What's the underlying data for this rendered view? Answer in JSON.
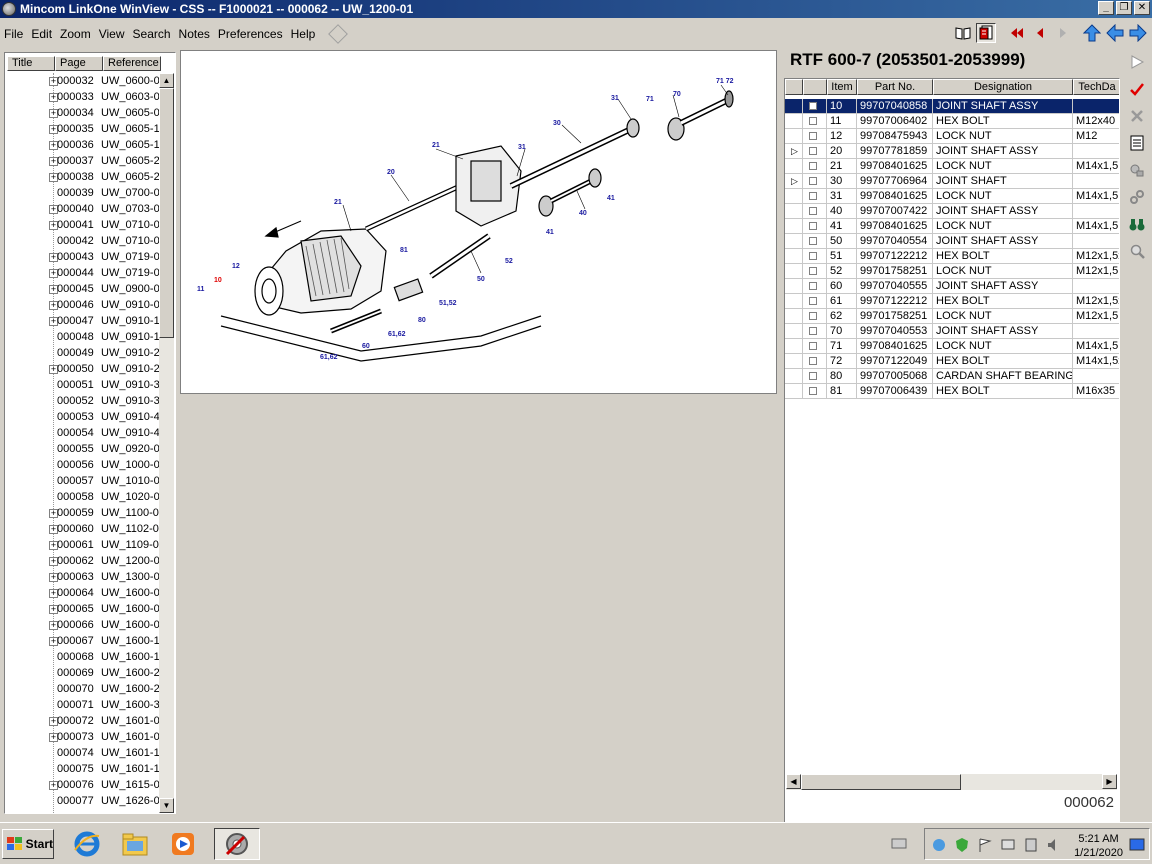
{
  "window": {
    "title": "Mincom LinkOne WinView - CSS -- F1000021 -- 000062 -- UW_1200-01",
    "buttons": [
      "_",
      "❐",
      "✕"
    ]
  },
  "menu": [
    {
      "label": "File"
    },
    {
      "label": "Edit"
    },
    {
      "label": "Zoom"
    },
    {
      "label": "View"
    },
    {
      "label": "Search"
    },
    {
      "label": "Notes"
    },
    {
      "label": "Preferences"
    },
    {
      "label": "Help"
    }
  ],
  "tree": {
    "headers": [
      "Title",
      "Page",
      "Reference"
    ],
    "rows": [
      {
        "title": "000032",
        "page": "UW_0600-0",
        "exp": true
      },
      {
        "title": "000033",
        "page": "UW_0603-0",
        "exp": true
      },
      {
        "title": "000034",
        "page": "UW_0605-0",
        "exp": true
      },
      {
        "title": "000035",
        "page": "UW_0605-1(",
        "exp": true
      },
      {
        "title": "000036",
        "page": "UW_0605-1!",
        "exp": true
      },
      {
        "title": "000037",
        "page": "UW_0605-2(",
        "exp": true
      },
      {
        "title": "000038",
        "page": "UW_0605-2!",
        "exp": true
      },
      {
        "title": "000039",
        "page": "UW_0700-0",
        "exp": false
      },
      {
        "title": "000040",
        "page": "UW_0703-0",
        "exp": true
      },
      {
        "title": "000041",
        "page": "UW_0710-0",
        "exp": true
      },
      {
        "title": "000042",
        "page": "UW_0710-0",
        "exp": false
      },
      {
        "title": "000043",
        "page": "UW_0719-0",
        "exp": true
      },
      {
        "title": "000044",
        "page": "UW_0719-0!",
        "exp": true
      },
      {
        "title": "000045",
        "page": "UW_0900-0",
        "exp": true
      },
      {
        "title": "000046",
        "page": "UW_0910-0",
        "exp": true
      },
      {
        "title": "000047",
        "page": "UW_0910-1(",
        "exp": true
      },
      {
        "title": "000048",
        "page": "UW_0910-1!",
        "exp": false
      },
      {
        "title": "000049",
        "page": "UW_0910-2(",
        "exp": false
      },
      {
        "title": "000050",
        "page": "UW_0910-2!",
        "exp": true
      },
      {
        "title": "000051",
        "page": "UW_0910-3(",
        "exp": false
      },
      {
        "title": "000052",
        "page": "UW_0910-3!",
        "exp": false
      },
      {
        "title": "000053",
        "page": "UW_0910-4(",
        "exp": false
      },
      {
        "title": "000054",
        "page": "UW_0910-4!",
        "exp": false
      },
      {
        "title": "000055",
        "page": "UW_0920-0",
        "exp": false
      },
      {
        "title": "000056",
        "page": "UW_1000-0",
        "exp": false
      },
      {
        "title": "000057",
        "page": "UW_1010-0",
        "exp": false
      },
      {
        "title": "000058",
        "page": "UW_1020-0",
        "exp": false
      },
      {
        "title": "000059",
        "page": "UW_1100-0",
        "exp": true
      },
      {
        "title": "000060",
        "page": "UW_1102-0",
        "exp": true
      },
      {
        "title": "000061",
        "page": "UW_1109-0",
        "exp": true
      },
      {
        "title": "000062",
        "page": "UW_1200-0",
        "exp": true
      },
      {
        "title": "000063",
        "page": "UW_1300-0",
        "exp": true
      },
      {
        "title": "000064",
        "page": "UW_1600-0",
        "exp": true
      },
      {
        "title": "000065",
        "page": "UW_1600-0",
        "exp": true
      },
      {
        "title": "000066",
        "page": "UW_1600-0!",
        "exp": true
      },
      {
        "title": "000067",
        "page": "UW_1600-1(",
        "exp": true
      },
      {
        "title": "000068",
        "page": "UW_1600-1!",
        "exp": false
      },
      {
        "title": "000069",
        "page": "UW_1600-2(",
        "exp": false
      },
      {
        "title": "000070",
        "page": "UW_1600-2!",
        "exp": false
      },
      {
        "title": "000071",
        "page": "UW_1600-3(",
        "exp": false
      },
      {
        "title": "000072",
        "page": "UW_1601-0",
        "exp": true
      },
      {
        "title": "000073",
        "page": "UW_1601-0!",
        "exp": true
      },
      {
        "title": "000074",
        "page": "UW_1601-1(",
        "exp": false
      },
      {
        "title": "000075",
        "page": "UW_1601-1!",
        "exp": false
      },
      {
        "title": "000076",
        "page": "UW_1615-0",
        "exp": true
      },
      {
        "title": "000077",
        "page": "UW_1626-0",
        "exp": false
      }
    ]
  },
  "diagram": {
    "callouts": [
      "10",
      "11",
      "12",
      "20",
      "21",
      "21",
      "30",
      "31",
      "31",
      "40",
      "41",
      "41",
      "50",
      "51",
      "52",
      "51_52",
      "60",
      "61_62",
      "61_62",
      "70",
      "71",
      "71 72",
      "80",
      "81"
    ]
  },
  "parts": {
    "title": "RTF 600-7 (2053501-2053999)",
    "headers": [
      "",
      "",
      "Item",
      "Part No.",
      "Designation",
      "TechDa"
    ],
    "rows": [
      {
        "arrow": "",
        "item": "10",
        "part": "99707040858",
        "desc": "JOINT SHAFT ASSY",
        "tech": "",
        "selected": true
      },
      {
        "arrow": "",
        "item": "11",
        "part": "99707006402",
        "desc": "HEX BOLT",
        "tech": "M12x40"
      },
      {
        "arrow": "",
        "item": "12",
        "part": "99708475943",
        "desc": "LOCK NUT",
        "tech": "M12"
      },
      {
        "arrow": "▷",
        "item": "20",
        "part": "99707781859",
        "desc": "JOINT SHAFT ASSY",
        "tech": ""
      },
      {
        "arrow": "",
        "item": "21",
        "part": "99708401625",
        "desc": "LOCK NUT",
        "tech": "M14x1,5"
      },
      {
        "arrow": "▷",
        "item": "30",
        "part": "99707706964",
        "desc": "JOINT SHAFT",
        "tech": ""
      },
      {
        "arrow": "",
        "item": "31",
        "part": "99708401625",
        "desc": "LOCK NUT",
        "tech": "M14x1,5"
      },
      {
        "arrow": "",
        "item": "40",
        "part": "99707007422",
        "desc": "JOINT SHAFT ASSY",
        "tech": ""
      },
      {
        "arrow": "",
        "item": "41",
        "part": "99708401625",
        "desc": "LOCK NUT",
        "tech": "M14x1,5"
      },
      {
        "arrow": "",
        "item": "50",
        "part": "99707040554",
        "desc": "JOINT SHAFT ASSY",
        "tech": ""
      },
      {
        "arrow": "",
        "item": "51",
        "part": "99707122212",
        "desc": "HEX BOLT",
        "tech": "M12x1,5x"
      },
      {
        "arrow": "",
        "item": "52",
        "part": "99701758251",
        "desc": "LOCK NUT",
        "tech": "M12x1,5"
      },
      {
        "arrow": "",
        "item": "60",
        "part": "99707040555",
        "desc": "JOINT SHAFT ASSY",
        "tech": ""
      },
      {
        "arrow": "",
        "item": "61",
        "part": "99707122212",
        "desc": "HEX BOLT",
        "tech": "M12x1,5x"
      },
      {
        "arrow": "",
        "item": "62",
        "part": "99701758251",
        "desc": "LOCK NUT",
        "tech": "M12x1,5"
      },
      {
        "arrow": "",
        "item": "70",
        "part": "99707040553",
        "desc": "JOINT SHAFT ASSY",
        "tech": ""
      },
      {
        "arrow": "",
        "item": "71",
        "part": "99708401625",
        "desc": "LOCK NUT",
        "tech": "M14x1,5"
      },
      {
        "arrow": "",
        "item": "72",
        "part": "99707122049",
        "desc": "HEX BOLT",
        "tech": "M14x1,5x"
      },
      {
        "arrow": "",
        "item": "80",
        "part": "99707005068",
        "desc": "CARDAN SHAFT BEARING",
        "tech": ""
      },
      {
        "arrow": "",
        "item": "81",
        "part": "99707006439",
        "desc": "HEX BOLT",
        "tech": "M16x35"
      }
    ],
    "page_code": "000062"
  },
  "taskbar": {
    "start_label": "Start",
    "time": "5:21 AM",
    "date": "1/21/2020"
  },
  "colors": {
    "title_gradient_start": "#0a246a",
    "selection": "#0a246a",
    "callout_text": "#1a1aa0",
    "callout_highlight": "#e00000"
  }
}
